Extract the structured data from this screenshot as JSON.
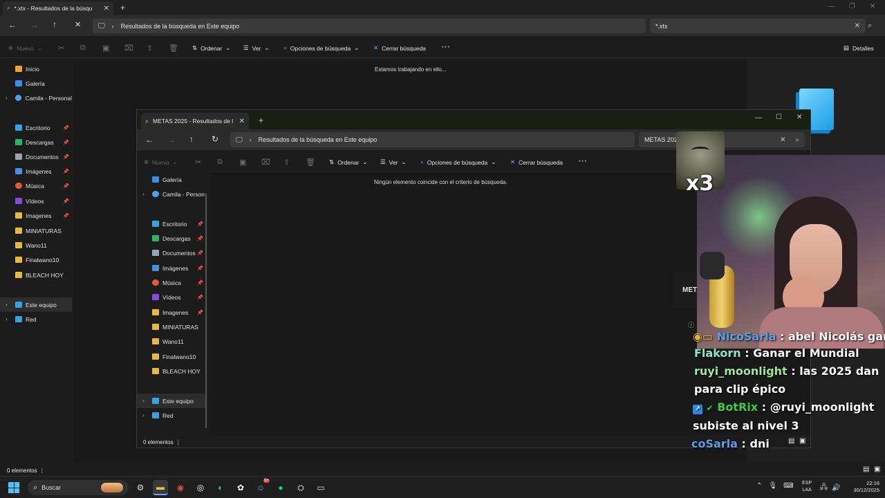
{
  "back_window": {
    "tab_title": "*.xtx - Resultados de la búsqu",
    "address": "Resultados de la búsqueda en Este equipo",
    "search_query": "*.xtx",
    "commands": {
      "new": "Nuevo",
      "sort": "Ordenar",
      "view": "Ver",
      "search_options": "Opciones de búsqueda",
      "close_search": "Cerrar búsqueda",
      "details": "Detalles"
    },
    "status_message": "Estamos trabajando en ello...",
    "sidebar": [
      {
        "label": "Inicio",
        "icon": "home-icon",
        "color": "#e8a33c"
      },
      {
        "label": "Galería",
        "icon": "gallery-icon",
        "color": "#3d8be8"
      },
      {
        "label": "Camila - Personal",
        "icon": "onedrive-icon",
        "color": "#4aa3f0"
      },
      {
        "label": "Escritorio",
        "icon": "desktop-icon",
        "color": "#3aa0e0",
        "pinned": true
      },
      {
        "label": "Descargas",
        "icon": "download-icon",
        "color": "#2fb36b",
        "pinned": true
      },
      {
        "label": "Documentos",
        "icon": "document-icon",
        "color": "#9aa4b0",
        "pinned": true
      },
      {
        "label": "Imágenes",
        "icon": "image-icon",
        "color": "#4a90d9",
        "pinned": true
      },
      {
        "label": "Música",
        "icon": "music-icon",
        "color": "#e05a3a",
        "pinned": true
      },
      {
        "label": "Vídeos",
        "icon": "video-icon",
        "color": "#8a4ad8",
        "pinned": true
      },
      {
        "label": "Imagenes",
        "icon": "folder-icon",
        "color": "#e8b93c",
        "pinned": true
      },
      {
        "label": "MINIATURAS",
        "icon": "folder-icon",
        "color": "#e8b93c"
      },
      {
        "label": "Wano11",
        "icon": "folder-icon",
        "color": "#e8b93c"
      },
      {
        "label": "Finalwano10",
        "icon": "folder-icon",
        "color": "#e8b93c"
      },
      {
        "label": "BLEACH HOY",
        "icon": "folder-icon",
        "color": "#e8b93c"
      },
      {
        "label": "Este equipo",
        "icon": "computer-icon",
        "color": "#3aa0e0"
      },
      {
        "label": "Red",
        "icon": "network-icon",
        "color": "#3aa0e0"
      }
    ],
    "status_bar": "0 elementos"
  },
  "front_window": {
    "tab_title": "METAS 2025 - Resultados de l",
    "address": "Resultados de la búsqueda en Este equipo",
    "search_query": "METAS 202",
    "commands": {
      "new": "Nuevo",
      "sort": "Ordenar",
      "view": "Ver",
      "search_options": "Opciones de búsqueda",
      "close_search": "Cerrar búsqueda"
    },
    "empty_message": "Ningún elemento coincide con el criterio de búsqueda.",
    "sidebar": [
      {
        "label": "Galería",
        "icon": "gallery-icon",
        "color": "#3d8be8"
      },
      {
        "label": "Camila - Person",
        "icon": "onedrive-icon",
        "color": "#4aa3f0"
      },
      {
        "label": "Escritorio",
        "icon": "desktop-icon",
        "color": "#3aa0e0",
        "pinned": true
      },
      {
        "label": "Descargas",
        "icon": "download-icon",
        "color": "#2fb36b",
        "pinned": true
      },
      {
        "label": "Documentos",
        "icon": "document-icon",
        "color": "#9aa4b0",
        "pinned": true
      },
      {
        "label": "Imágenes",
        "icon": "image-icon",
        "color": "#4a90d9",
        "pinned": true
      },
      {
        "label": "Música",
        "icon": "music-icon",
        "color": "#e05a3a",
        "pinned": true
      },
      {
        "label": "Vídeos",
        "icon": "video-icon",
        "color": "#8a4ad8",
        "pinned": true
      },
      {
        "label": "Imagenes",
        "icon": "folder-icon",
        "color": "#e8b93c",
        "pinned": true
      },
      {
        "label": "MINIATURAS",
        "icon": "folder-icon",
        "color": "#e8b93c"
      },
      {
        "label": "Wano11",
        "icon": "folder-icon",
        "color": "#e8b93c"
      },
      {
        "label": "Finalwano10",
        "icon": "folder-icon",
        "color": "#e8b93c"
      },
      {
        "label": "BLEACH HOY",
        "icon": "folder-icon",
        "color": "#e8b93c"
      },
      {
        "label": "Este equipo",
        "icon": "computer-icon",
        "color": "#3aa0e0"
      },
      {
        "label": "Red",
        "icon": "network-icon",
        "color": "#3aa0e0"
      }
    ],
    "status_bar": "0 elementos"
  },
  "stream_overlay": {
    "partial_label": "META",
    "emote_text": "x3",
    "chat": [
      {
        "user": "NicoSarla",
        "text": " : abel Nicolás garay",
        "color": "#5aa0e8"
      },
      {
        "user": "Flakorn",
        "text": " : Ganar el Mundial",
        "color": "#8ae8c8"
      },
      {
        "user": "ruyi_moonlight",
        "text": " : las 2025 dan para clip épico",
        "color": "#9ae89a"
      },
      {
        "user": "BotRix",
        "text": " : @ruyi_moonlight subiste al nivel 3",
        "color": "#3ad03a"
      },
      {
        "user": "coSarla",
        "text": " : dni",
        "color": "#5aa0e8"
      }
    ]
  },
  "taskbar": {
    "search_placeholder": "Buscar",
    "language": "ESP",
    "layout": "LAA",
    "time": "22:16",
    "date": "30/12/2025",
    "discord_badge": "9+"
  }
}
